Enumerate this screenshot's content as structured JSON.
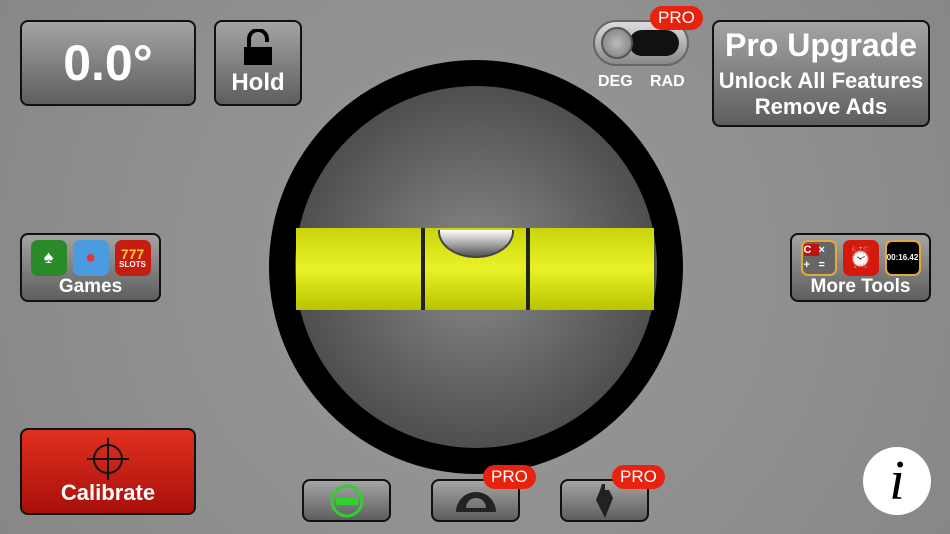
{
  "angle": {
    "value": "0.0°"
  },
  "hold": {
    "label": "Hold",
    "icon": "unlock-icon"
  },
  "units": {
    "deg": "DEG",
    "rad": "RAD",
    "selected": "DEG",
    "pro_badge": "PRO"
  },
  "upgrade": {
    "title": "Pro Upgrade",
    "line1": "Unlock All Features",
    "line2": "Remove Ads"
  },
  "games": {
    "label": "Games",
    "icons": [
      "solitaire-icon",
      "bird-game-icon",
      "slots-icon"
    ],
    "slots_text": "777",
    "slots_sub": "SLOTS"
  },
  "tools": {
    "label": "More Tools",
    "calc_keys": [
      "C",
      "×",
      "+",
      "="
    ],
    "stopwatch": "00:16.42",
    "icons": [
      "calculator-icon",
      "alarm-clock-icon",
      "stopwatch-icon"
    ]
  },
  "calibrate": {
    "label": "Calibrate"
  },
  "modes": [
    {
      "name": "bubble-level",
      "pro": false
    },
    {
      "name": "protractor",
      "pro": true,
      "badge": "PRO"
    },
    {
      "name": "plumb-bob",
      "pro": true,
      "badge": "PRO"
    }
  ],
  "info": {
    "label": "i"
  },
  "colors": {
    "vial": "#e2ec1e",
    "calibrate": "#cc1a0e",
    "pro": "#e8220e",
    "active_mode": "#2fd12f"
  }
}
